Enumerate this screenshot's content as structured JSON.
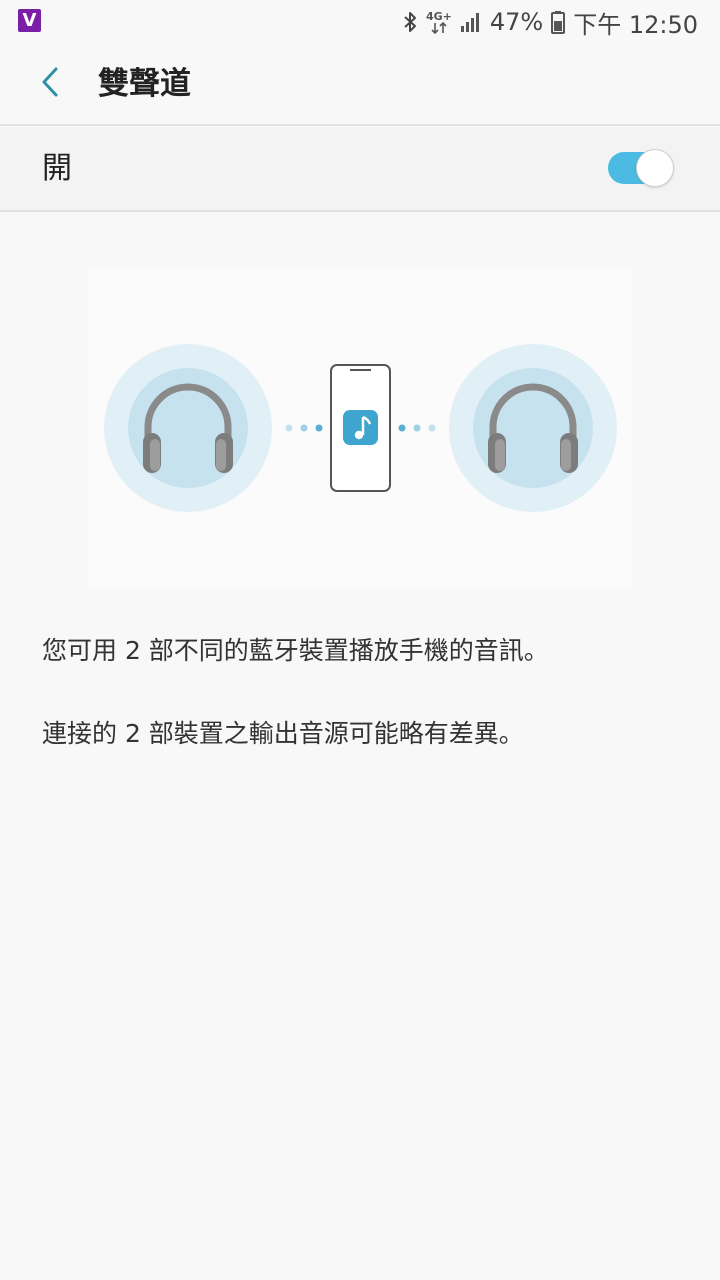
{
  "status_bar": {
    "app_badge": "V",
    "network_label": "4G+",
    "battery": "47%",
    "time": "下午 12:50",
    "icons": [
      "bluetooth-icon",
      "network-4g-icon",
      "signal-icon",
      "battery-icon"
    ]
  },
  "header": {
    "back_icon": "chevron-left-icon",
    "title": "雙聲道"
  },
  "switch": {
    "label": "開",
    "on": true,
    "accent_color": "#4bbbe3"
  },
  "illustration": {
    "icons": [
      "headphones-icon",
      "phone-icon",
      "music-note-icon",
      "headphones-icon"
    ]
  },
  "description": {
    "line1": "您可用 2 部不同的藍牙裝置播放手機的音訊。",
    "line2": "連接的 2 部裝置之輸出音源可能略有差異。"
  }
}
